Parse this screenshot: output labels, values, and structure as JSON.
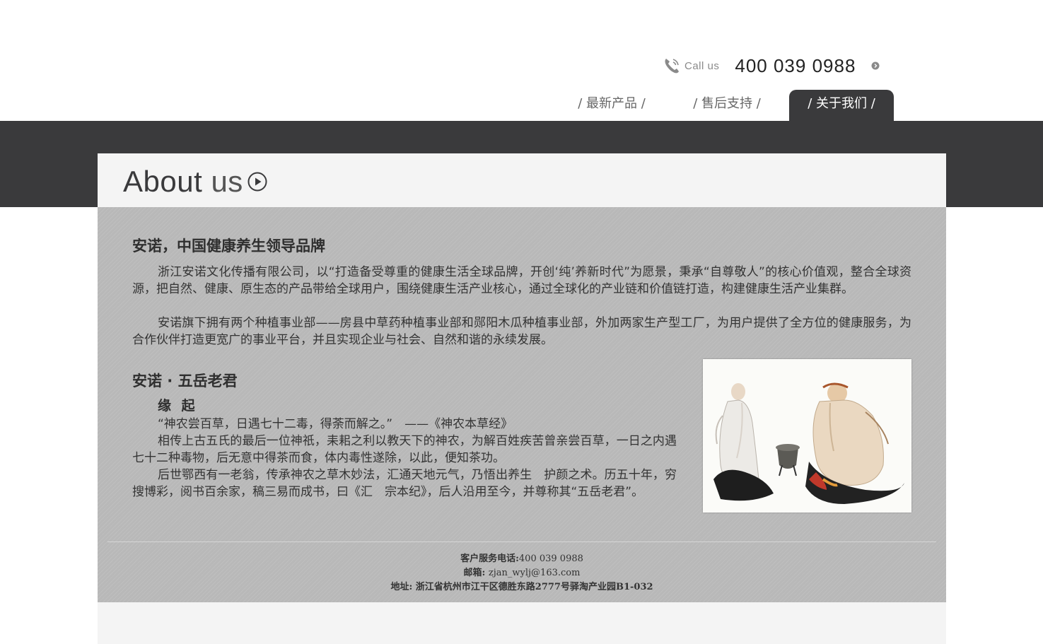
{
  "header": {
    "callus_label": "Call us",
    "phone_number": "400 039 0988"
  },
  "nav": {
    "items": [
      {
        "label": "/ 最新产品 /"
      },
      {
        "label": "/ 售后支持 /"
      },
      {
        "label": "/ 关于我们 /"
      }
    ]
  },
  "about": {
    "title_about": "About",
    "title_us": "us"
  },
  "section1": {
    "title": "安诺，中国健康养生领导品牌",
    "para1": "浙江安诺文化传播有限公司，以“打造备受尊重的健康生活全球品牌，开创‘纯’养新时代”为愿景，秉承“自尊敬人”的核心价值观，整合全球资源，把自然、健康、原生态的产品带给全球用户，围绕健康生活产业核心，通过全球化的产业链和价值链打造，构建健康生活产业集群。",
    "para2": "安诺旗下拥有两个种植事业部——房县中草药种植事业部和郧阳木瓜种植事业部，外加两家生产型工厂，为用户提供了全方位的健康服务，为合作伙伴打造更宽广的事业平台，并且实现企业与社会、自然和谐的永续发展。"
  },
  "section2": {
    "title": "安诺 · 五岳老君",
    "subtitle": "缘 起",
    "quote": "“神农尝百草，日遇七十二毒，得荼而解之。”　——《神农本草经》",
    "para1": "相传上古五氏的最后一位神祇，耒耜之利以教天下的神农，为解百姓疾苦曾亲尝百草，一日之内遇七十二种毒物，后无意中得茶而食，体内毒性遂除，以此，便知茶功。",
    "para2": "后世鄂西有一老翁，传承神农之草木妙法，汇通天地元气，乃悟出养生　护颜之术。历五十年，穷搜博彩，阅书百余家，稿三易而成书，曰《汇　宗本纪》，后人沿用至今，并尊称其“五岳老君”。"
  },
  "footer": {
    "phone_label": "客户服务电话:",
    "phone_value": "400 039 0988",
    "email_label": "邮箱:",
    "email_value": "zjan_wylj@163.com",
    "address_label": "地址:",
    "address_value": "浙江省杭州市江干区德胜东路2777号驿淘产业园B1-032"
  },
  "colors": {
    "dark_band": "#3a3a3c",
    "content_bg": "#b8b8b8",
    "panel_bg": "#f4f4f4"
  },
  "icons": [
    "phone-icon",
    "circle-arrow-icon",
    "play-circle-icon"
  ]
}
